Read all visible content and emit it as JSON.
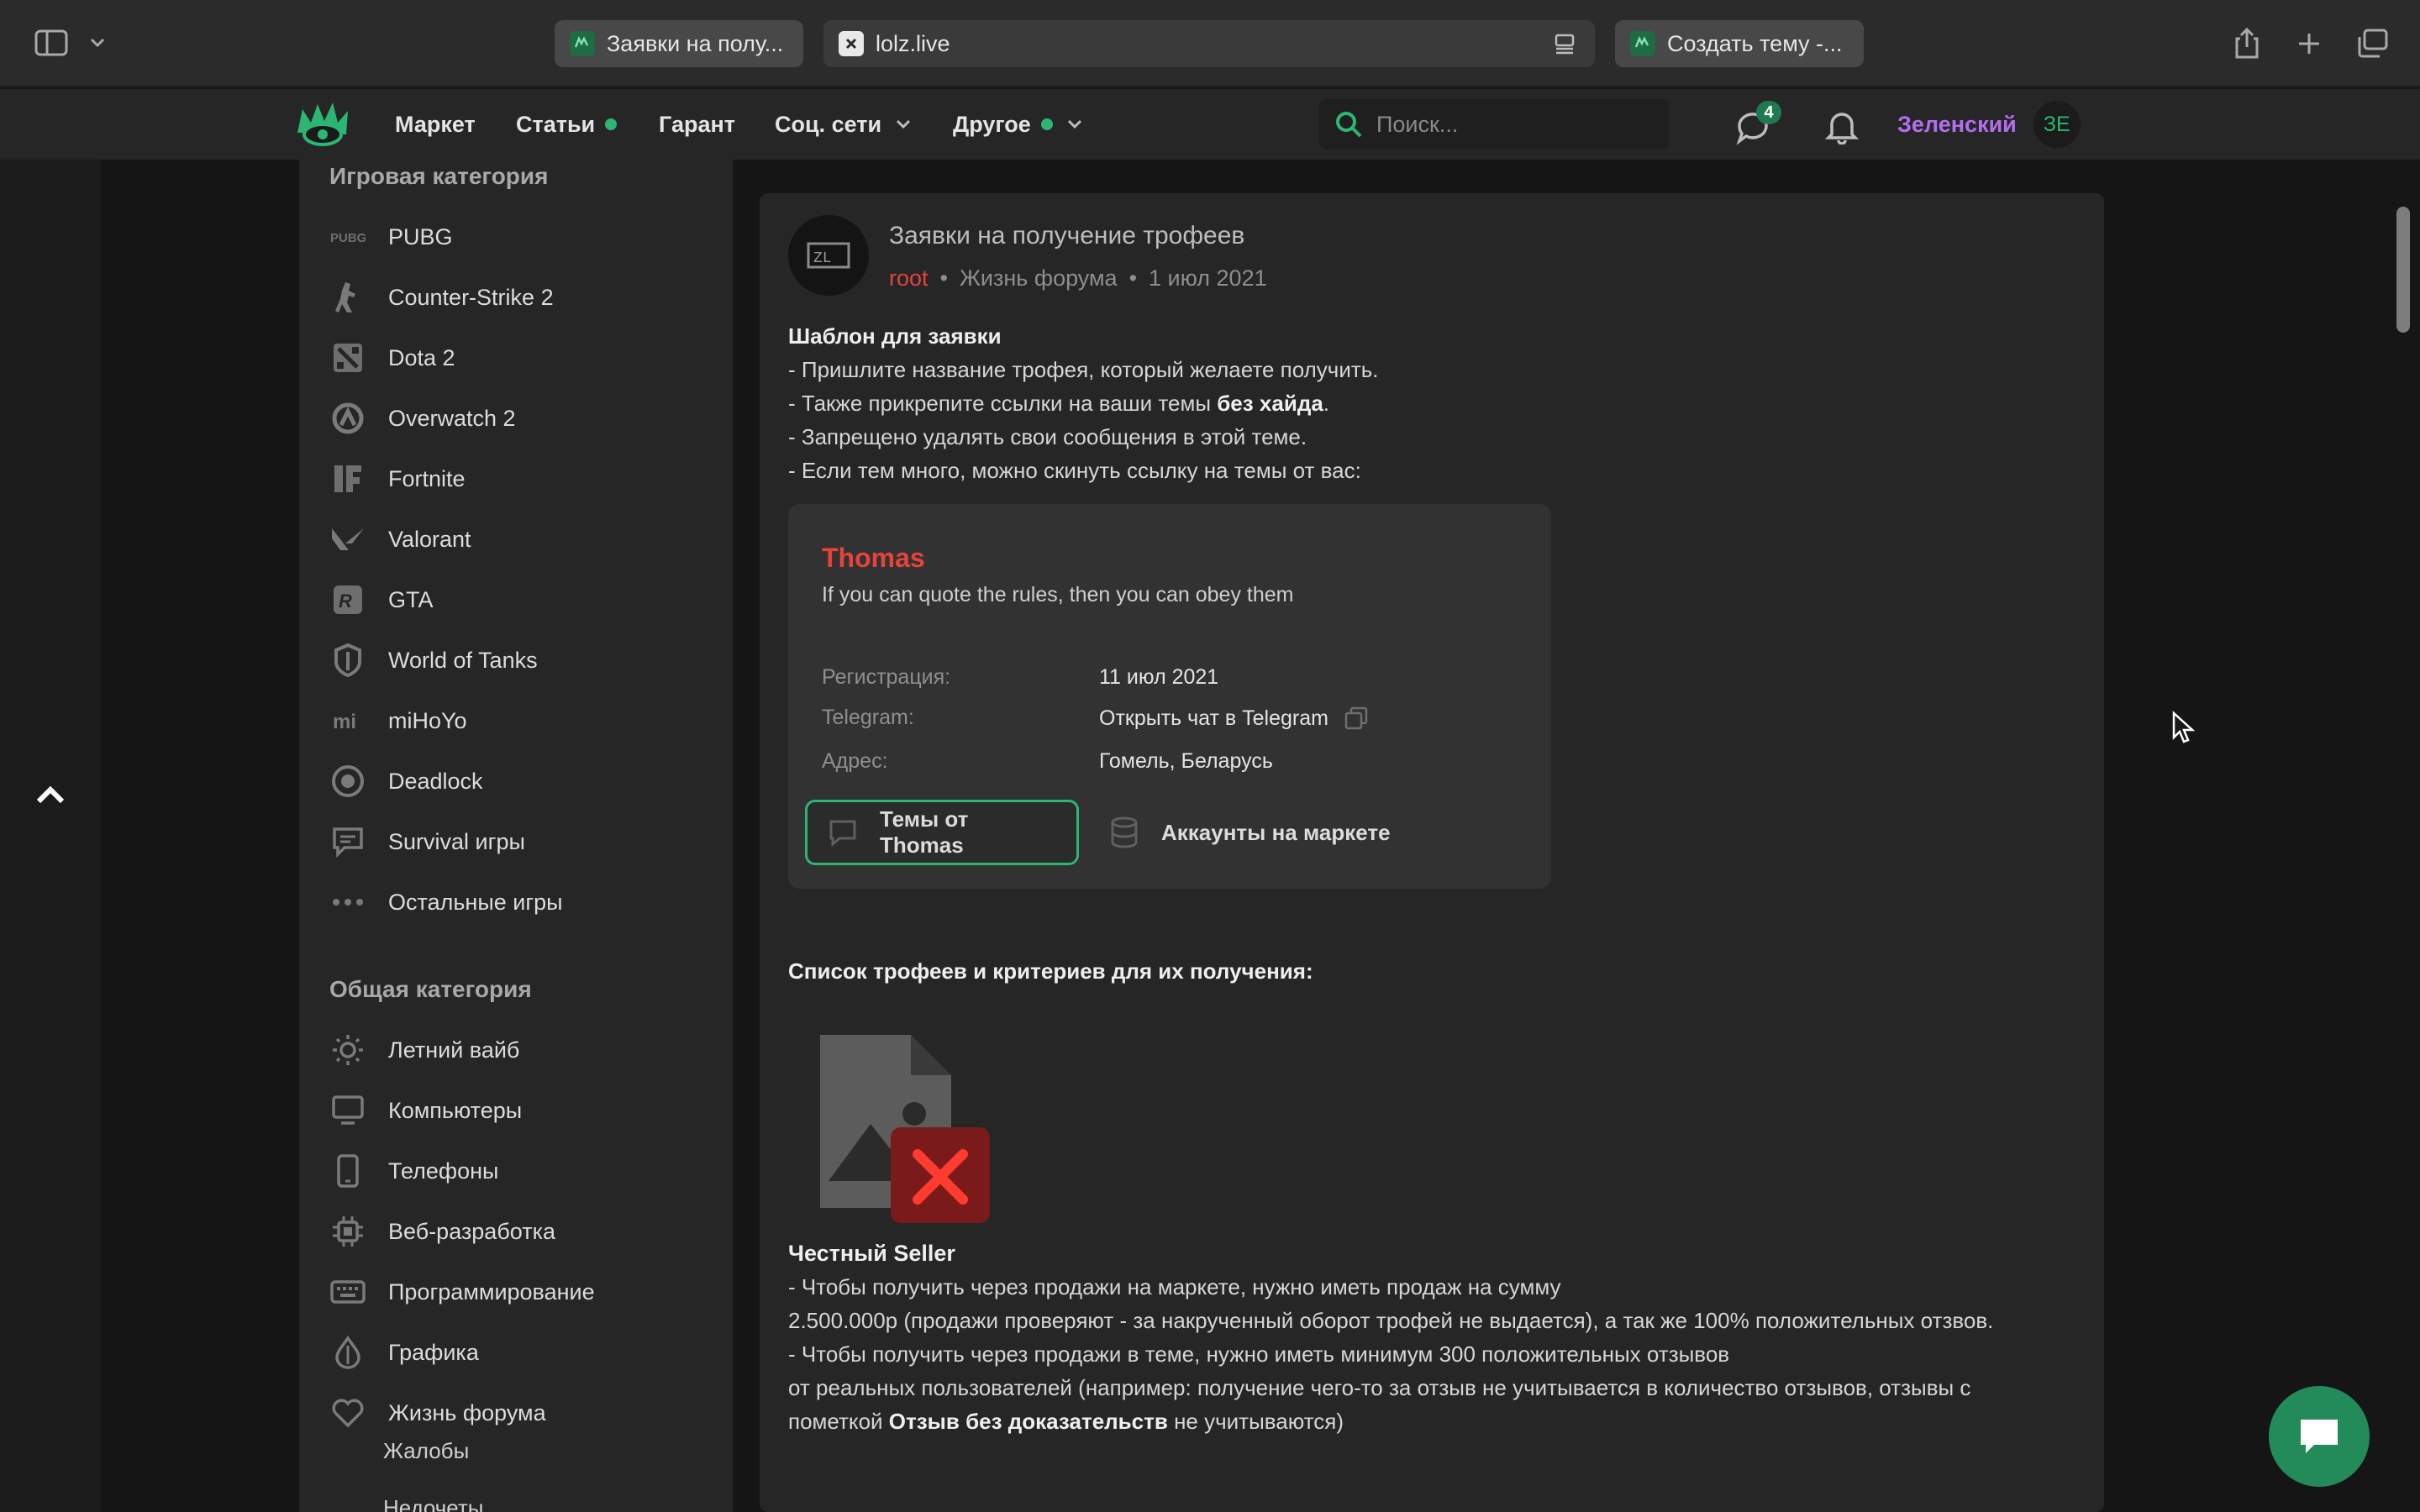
{
  "browser": {
    "tabs": [
      {
        "label": "Заявки на полу...",
        "active": false
      },
      {
        "label": "lolz.live",
        "active": true
      },
      {
        "label": "Создать тему -...",
        "active": false
      }
    ]
  },
  "header": {
    "nav": [
      {
        "label": "Маркет",
        "dot": false,
        "chevron": false
      },
      {
        "label": "Статьи",
        "dot": true,
        "chevron": false
      },
      {
        "label": "Гарант",
        "dot": false,
        "chevron": false
      },
      {
        "label": "Соц. сети",
        "dot": false,
        "chevron": true
      },
      {
        "label": "Другое",
        "dot": true,
        "chevron": true
      }
    ],
    "search_placeholder": "Поиск...",
    "messages_badge": "4",
    "username": "Зеленский",
    "avatar_initials": "ЗЕ"
  },
  "sidebar": {
    "game_section_title": "Игровая категория",
    "game_items": [
      {
        "label": "PUBG",
        "icon": "pubg-icon"
      },
      {
        "label": "Counter-Strike 2",
        "icon": "cs2-icon"
      },
      {
        "label": "Dota 2",
        "icon": "dota-icon"
      },
      {
        "label": "Overwatch 2",
        "icon": "overwatch-icon"
      },
      {
        "label": "Fortnite",
        "icon": "fortnite-icon"
      },
      {
        "label": "Valorant",
        "icon": "valorant-icon"
      },
      {
        "label": "GTA",
        "icon": "gta-icon"
      },
      {
        "label": "World of Tanks",
        "icon": "tank-icon"
      },
      {
        "label": "miHoYo",
        "icon": "mihoyo-icon"
      },
      {
        "label": "Deadlock",
        "icon": "deadlock-icon"
      },
      {
        "label": "Survival игры",
        "icon": "chat-bubble-icon"
      },
      {
        "label": "Остальные игры",
        "icon": "more-dots-icon"
      }
    ],
    "general_section_title": "Общая категория",
    "general_items": [
      {
        "label": "Летний вайб",
        "icon": "sun-icon"
      },
      {
        "label": "Компьютеры",
        "icon": "monitor-icon"
      },
      {
        "label": "Телефоны",
        "icon": "phone-icon"
      },
      {
        "label": "Веб-разработка",
        "icon": "chip-icon"
      },
      {
        "label": "Программирование",
        "icon": "keyboard-icon"
      },
      {
        "label": "Графика",
        "icon": "drop-icon"
      },
      {
        "label": "Жизнь форума",
        "icon": "heart-icon"
      }
    ],
    "sub_items": [
      "Жалобы",
      "Недочеты"
    ]
  },
  "post": {
    "title": "Заявки на получение трофеев",
    "author": "root",
    "forum": "Жизнь форума",
    "date": "1 июл 2021",
    "template_heading": "Шаблон для заявки",
    "line1": "- Пришлите название трофея, который желаете получить.",
    "line2_prefix": "- Также прикрепите ссылки на ваши темы ",
    "line2_bold": "без хайда",
    "line2_suffix": ".",
    "line3": "- Запрещено удалять свои сообщения в этой теме.",
    "line4": "- Если тем много, можно скинуть ссылку на темы от вас:",
    "card": {
      "name": "Thomas",
      "status": "If you can quote the rules, then you can obey them",
      "reg_label": "Регистрация:",
      "reg_value": "11 июл 2021",
      "tg_label": "Telegram:",
      "tg_value": "Открыть чат в Telegram",
      "addr_label": "Адрес:",
      "addr_value": "Гомель, Беларусь",
      "btn_topics": "Темы от Thomas",
      "btn_accounts": "Аккаунты на маркете"
    },
    "trophies_heading": "Список трофеев и критериев для их получения:",
    "seller_heading": "Честный Seller",
    "seller_line1": "- Чтобы получить через продажи на маркете, нужно иметь продаж на сумму",
    "seller_line2": "2.500.000р (продажи проверяют - за накрученный оборот трофей не выдается), а так же 100% положительных отзвов.",
    "seller_line3": "- Чтобы получить через продажи в теме, нужно иметь минимум 300 положительных отзывов",
    "seller_line4": "от реальных пользователей (например: получение чего-то за отзыв не учитывается в количество отзывов, отзывы с",
    "seller_line5_prefix": "пометкой ",
    "seller_line5_bold": "Отзыв без доказательств",
    "seller_line5_suffix": " не учитываются)"
  },
  "colors": {
    "accent_green": "#2bb673",
    "author_red": "#e5433c",
    "username_purple": "#b36ef0"
  }
}
